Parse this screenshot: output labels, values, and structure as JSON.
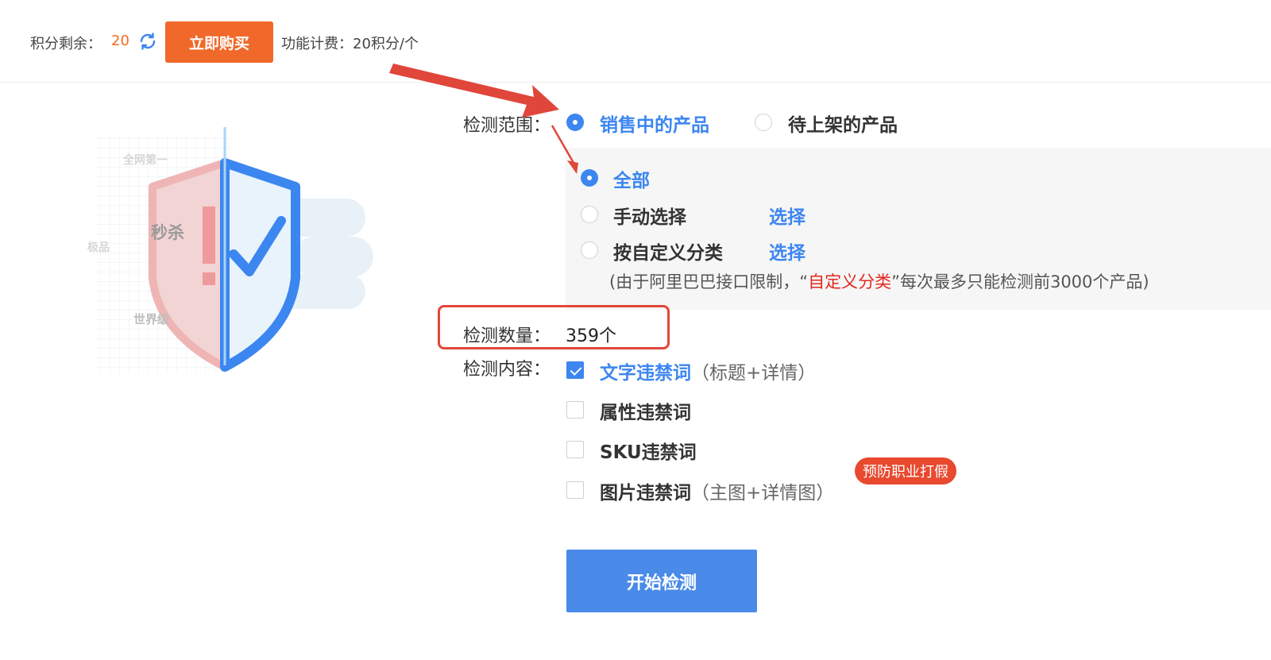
{
  "header": {
    "points_label": "积分剩余：",
    "points_value": "20",
    "buy_button": "立即购买",
    "fee_text": "功能计费：20积分/个",
    "refresh_icon": "refresh-icon"
  },
  "illustration": {
    "tag_top": "全网第一",
    "tag_middle": "秒杀",
    "tag_left": "极品",
    "tag_bottom": "世界级"
  },
  "scope": {
    "label": "检测范围：",
    "options": [
      "销售中的产品",
      "待上架的产品"
    ],
    "selected": "销售中的产品"
  },
  "range": {
    "options": [
      "全部",
      "手动选择",
      "按自定义分类"
    ],
    "selected": "全部",
    "select_link": "选择",
    "note_prefix": "(由于阿里巴巴接口限制，“",
    "note_highlight": "自定义分类",
    "note_suffix": "”每次最多只能检测前3000个产品)"
  },
  "count": {
    "label": "检测数量：",
    "value": "359个"
  },
  "content": {
    "label": "检测内容：",
    "items": [
      {
        "name": "文字违禁词",
        "sub": "（标题+详情）",
        "checked": true
      },
      {
        "name": "属性违禁词",
        "sub": "",
        "checked": false
      },
      {
        "name": "SKU违禁词",
        "sub": "",
        "checked": false
      },
      {
        "name": "图片违禁词",
        "sub": "（主图+详情图）",
        "checked": false
      }
    ],
    "badge": "预防职业打假"
  },
  "start_button": "开始检测",
  "colors": {
    "accent": "#3c86f0",
    "orange": "#f0692a",
    "annotation_red": "#e2473a"
  }
}
